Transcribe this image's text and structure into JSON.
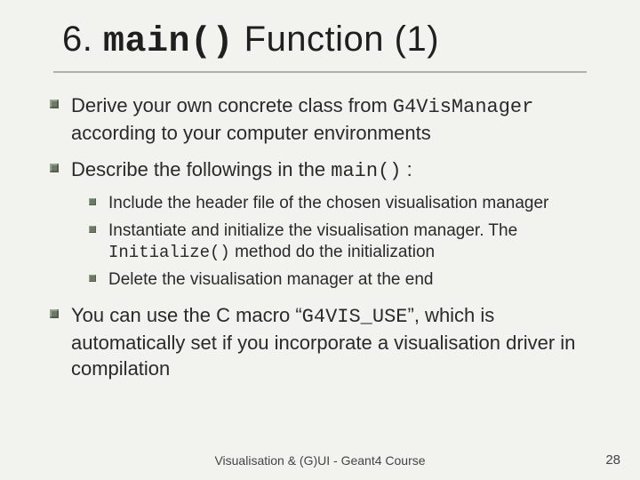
{
  "title": {
    "prefix": "6. ",
    "mono": "main()",
    "suffix": " Function (1)"
  },
  "bullets": {
    "b1_a": "Derive your own concrete class from ",
    "b1_mono": "G4VisManager",
    "b1_b": " according to your computer environments",
    "b2_a": "Describe the followings in the ",
    "b2_mono": "main()",
    "b2_b": " :",
    "sub1": "Include the header file of the chosen visualisation manager",
    "sub2_a": "Instantiate and initialize the visualisation manager. The ",
    "sub2_mono": "Initialize()",
    "sub2_b": " method do the initialization",
    "sub3": "Delete the visualisation manager at the end",
    "b3_a": "You can use the C macro “",
    "b3_mono": "G4VIS_USE",
    "b3_b": "”, which is automatically set if you incorporate a visualisation driver in compilation"
  },
  "footer": "Visualisation & (G)UI - Geant4 Course",
  "pagenum": "28"
}
